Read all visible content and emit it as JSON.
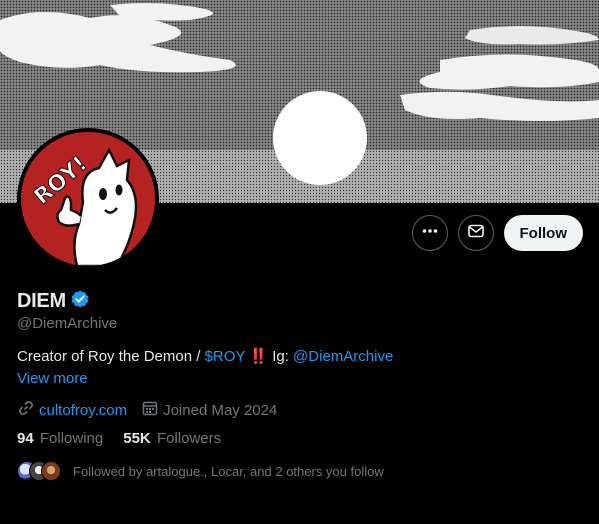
{
  "profile": {
    "display_name": "DIEM",
    "verified_icon": "verified-badge-icon",
    "handle": "@DiemArchive",
    "bio": {
      "prefix": "Creator of Roy the Demon / ",
      "ticker": "$ROY",
      "emphasis": "‼️",
      "ig_label": " Ig: ",
      "ig_handle": "@DiemArchive"
    },
    "view_more": "View more",
    "website": "cultofroy.com",
    "joined": "Joined May 2024"
  },
  "stats": {
    "following_count": "94",
    "following_label": "Following",
    "followers_count": "55K",
    "followers_label": "Followers"
  },
  "followed_by": "Followed by artalogue., Locar, and 2 others you follow",
  "actions": {
    "more_icon": "more-icon",
    "message_icon": "mail-icon",
    "follow_label": "Follow"
  },
  "colors": {
    "accent": "#1d9bf0",
    "background": "#000000",
    "avatar_red": "#b52222"
  }
}
